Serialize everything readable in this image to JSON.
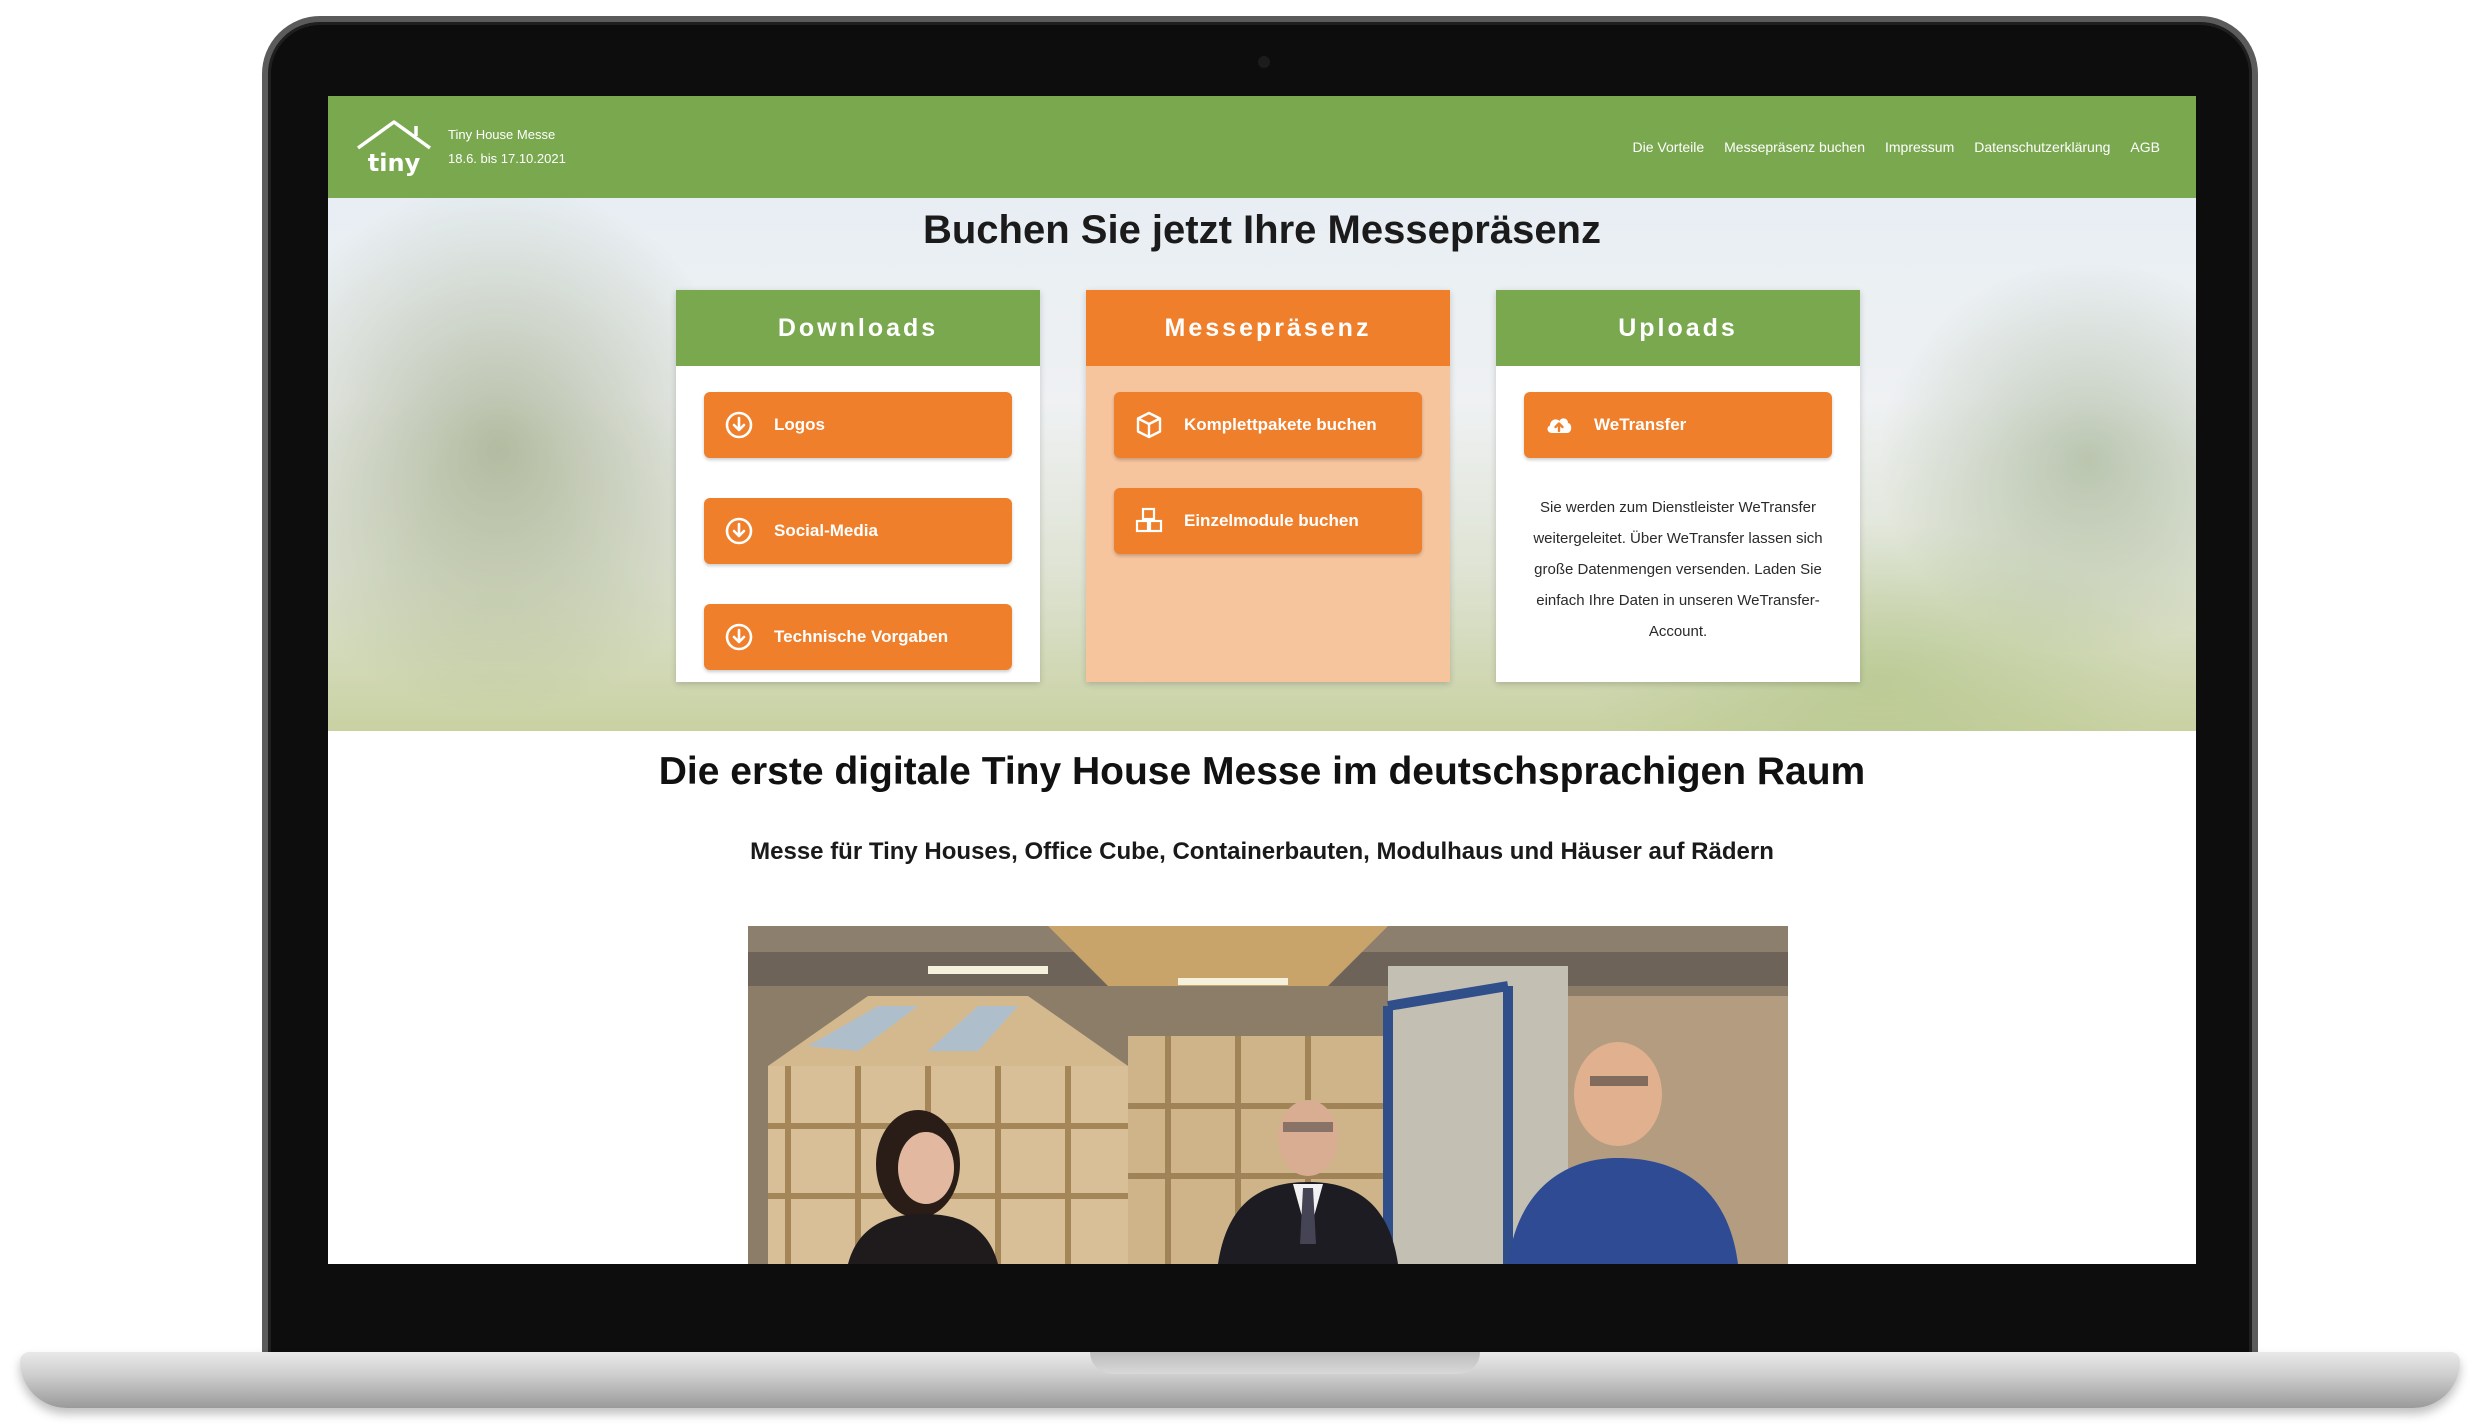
{
  "header": {
    "brand_line1": "Tiny House Messe",
    "brand_line2": "18.6. bis 17.10.2021",
    "logo_text": "tiny",
    "nav": [
      {
        "label": "Die Vorteile"
      },
      {
        "label": "Messepräsenz buchen"
      },
      {
        "label": "Impressum"
      },
      {
        "label": "Datenschutzerklärung"
      },
      {
        "label": "AGB"
      }
    ]
  },
  "hero": {
    "title": "Buchen Sie jetzt Ihre Messepräsenz",
    "cards": {
      "downloads": {
        "title": "Downloads",
        "buttons": [
          {
            "label": "Logos",
            "icon": "download-circle-icon"
          },
          {
            "label": "Social-Media",
            "icon": "download-circle-icon"
          },
          {
            "label": "Technische Vorgaben",
            "icon": "download-circle-icon"
          }
        ]
      },
      "messe": {
        "title": "Messepräsenz",
        "buttons": [
          {
            "label": "Komplettpakete buchen",
            "icon": "box-icon"
          },
          {
            "label": "Einzelmodule buchen",
            "icon": "cubes-icon"
          }
        ]
      },
      "uploads": {
        "title": "Uploads",
        "button": {
          "label": "WeTransfer",
          "icon": "cloud-upload-icon"
        },
        "description": "Sie werden zum Dienstleister WeTransfer weitergeleitet. Über WeTransfer lassen sich große Datenmengen versenden. Laden Sie einfach Ihre Daten in unseren WeTransfer-Account."
      }
    }
  },
  "content": {
    "title": "Die erste digitale Tiny House Messe im deutschsprachigen Raum",
    "subtitle": "Messe für Tiny Houses, Office Cube, Containerbauten, Modulhaus und Häuser auf Rädern"
  },
  "colors": {
    "green": "#79a84f",
    "orange": "#ef7f2b",
    "light_orange": "#f6c49d"
  }
}
